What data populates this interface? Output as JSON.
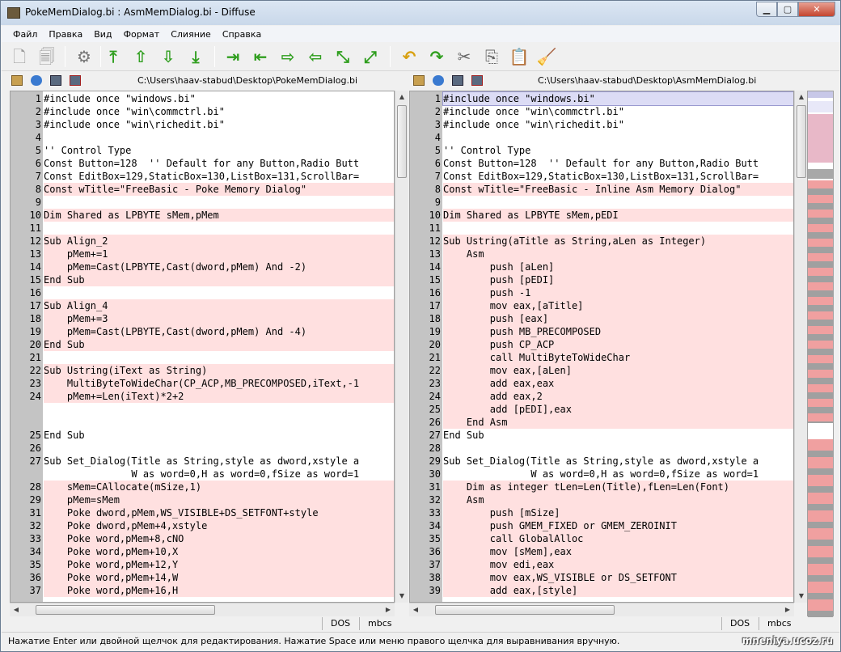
{
  "window": {
    "title": "PokeMemDialog.bi : AsmMemDialog.bi - Diffuse",
    "min_glyph": "▁",
    "max_glyph": "▢",
    "close_glyph": "✕"
  },
  "menu": [
    "Файл",
    "Правка",
    "Вид",
    "Формат",
    "Слияние",
    "Справка"
  ],
  "toolbar_icons": [
    {
      "name": "new-file-icon",
      "glyph": "🗋"
    },
    {
      "name": "new-2way-icon",
      "glyph": "🗐"
    },
    {
      "name": "preferences-icon",
      "glyph": "⚙"
    },
    {
      "name": "first-change-icon",
      "glyph": "⤒"
    },
    {
      "name": "previous-change-icon",
      "glyph": "⇧"
    },
    {
      "name": "next-change-icon",
      "glyph": "⇩"
    },
    {
      "name": "last-change-icon",
      "glyph": "⤓"
    },
    {
      "name": "copy-right-icon",
      "glyph": "⇥"
    },
    {
      "name": "copy-left-icon",
      "glyph": "⇤"
    },
    {
      "name": "copy-selection-right-icon",
      "glyph": "⇨"
    },
    {
      "name": "copy-selection-left-icon",
      "glyph": "⇦"
    },
    {
      "name": "merge-from-left-right-icon",
      "glyph": "⤡"
    },
    {
      "name": "merge-from-right-left-icon",
      "glyph": "⤢"
    },
    {
      "name": "undo-icon",
      "glyph": "↶"
    },
    {
      "name": "redo-icon",
      "glyph": "↷"
    },
    {
      "name": "cut-icon",
      "glyph": "✂"
    },
    {
      "name": "copy-icon",
      "glyph": "⎘"
    },
    {
      "name": "paste-icon",
      "glyph": "📋"
    },
    {
      "name": "clear-edits-icon",
      "glyph": "🧹"
    }
  ],
  "left_pane": {
    "path": "C:\\Users\\haav-stabud\\Desktop\\PokeMemDialog.bi",
    "eol": "DOS",
    "encoding": "mbcs",
    "lines": [
      {
        "n": "1",
        "t": "#include once \"windows.bi\"",
        "s": "plain"
      },
      {
        "n": "2",
        "t": "#include once \"win\\commctrl.bi\"",
        "s": "plain"
      },
      {
        "n": "3",
        "t": "#include once \"win\\richedit.bi\"",
        "s": "plain"
      },
      {
        "n": "4",
        "t": "",
        "s": "plain"
      },
      {
        "n": "5",
        "t": "'' Control Type",
        "s": "plain"
      },
      {
        "n": "6",
        "t": "Const Button=128  '' Default for any Button,Radio Butt",
        "s": "plain"
      },
      {
        "n": "7",
        "t": "Const EditBox=129,StaticBox=130,ListBox=131,ScrollBar=",
        "s": "plain"
      },
      {
        "n": "8",
        "t": "Const wTitle=\"FreeBasic - Poke Memory Dialog\"",
        "s": "diff"
      },
      {
        "n": "9",
        "t": "",
        "s": "plain"
      },
      {
        "n": "10",
        "t": "Dim Shared as LPBYTE sMem,pMem",
        "s": "diff"
      },
      {
        "n": "11",
        "t": "",
        "s": "plain"
      },
      {
        "n": "12",
        "t": "Sub Align_2",
        "s": "diff"
      },
      {
        "n": "13",
        "t": "    pMem+=1",
        "s": "diff"
      },
      {
        "n": "14",
        "t": "    pMem=Cast(LPBYTE,Cast(dword,pMem) And -2)",
        "s": "diff"
      },
      {
        "n": "15",
        "t": "End Sub",
        "s": "diff"
      },
      {
        "n": "16",
        "t": "",
        "s": "diff"
      },
      {
        "n": "17",
        "t": "Sub Align_4",
        "s": "diff"
      },
      {
        "n": "18",
        "t": "    pMem+=3",
        "s": "diff"
      },
      {
        "n": "19",
        "t": "    pMem=Cast(LPBYTE,Cast(dword,pMem) And -4)",
        "s": "diff"
      },
      {
        "n": "20",
        "t": "End Sub",
        "s": "diff"
      },
      {
        "n": "21",
        "t": "",
        "s": "diff"
      },
      {
        "n": "22",
        "t": "Sub Ustring(iText as String)",
        "s": "diff"
      },
      {
        "n": "23",
        "t": "    MultiByteToWideChar(CP_ACP,MB_PRECOMPOSED,iText,-1",
        "s": "diff"
      },
      {
        "n": "24",
        "t": "    pMem+=Len(iText)*2+2",
        "s": "diff"
      },
      {
        "n": "",
        "t": "",
        "s": "filler"
      },
      {
        "n": "",
        "t": "",
        "s": "filler"
      },
      {
        "n": "25",
        "t": "End Sub",
        "s": "plain"
      },
      {
        "n": "26",
        "t": "",
        "s": "plain"
      },
      {
        "n": "27",
        "t": "Sub Set_Dialog(Title as String,style as dword,xstyle a",
        "s": "plain"
      },
      {
        "n": "",
        "t": "               W as word=0,H as word=0,fSize as word=1",
        "s": "plain"
      },
      {
        "n": "28",
        "t": "    sMem=CAllocate(mSize,1)",
        "s": "diff"
      },
      {
        "n": "29",
        "t": "    pMem=sMem",
        "s": "diff"
      },
      {
        "n": "31",
        "t": "    Poke dword,pMem,WS_VISIBLE+DS_SETFONT+style",
        "s": "diff"
      },
      {
        "n": "32",
        "t": "    Poke dword,pMem+4,xstyle",
        "s": "diff"
      },
      {
        "n": "33",
        "t": "    Poke word,pMem+8,cNO",
        "s": "diff"
      },
      {
        "n": "34",
        "t": "    Poke word,pMem+10,X",
        "s": "diff"
      },
      {
        "n": "35",
        "t": "    Poke word,pMem+12,Y",
        "s": "diff"
      },
      {
        "n": "36",
        "t": "    Poke word,pMem+14,W",
        "s": "diff"
      },
      {
        "n": "37",
        "t": "    Poke word,pMem+16,H",
        "s": "diff"
      }
    ]
  },
  "right_pane": {
    "path": "C:\\Users\\haav-stabud\\Desktop\\AsmMemDialog.bi",
    "eol": "DOS",
    "encoding": "mbcs",
    "lines": [
      {
        "n": "1",
        "t": "#include once \"windows.bi\"",
        "s": "cur"
      },
      {
        "n": "2",
        "t": "#include once \"win\\commctrl.bi\"",
        "s": "plain"
      },
      {
        "n": "3",
        "t": "#include once \"win\\richedit.bi\"",
        "s": "plain"
      },
      {
        "n": "4",
        "t": "",
        "s": "plain"
      },
      {
        "n": "5",
        "t": "'' Control Type",
        "s": "plain"
      },
      {
        "n": "6",
        "t": "Const Button=128  '' Default for any Button,Radio Butt",
        "s": "plain"
      },
      {
        "n": "7",
        "t": "Const EditBox=129,StaticBox=130,ListBox=131,ScrollBar=",
        "s": "plain"
      },
      {
        "n": "8",
        "t": "Const wTitle=\"FreeBasic - Inline Asm Memory Dialog\"",
        "s": "diff"
      },
      {
        "n": "9",
        "t": "",
        "s": "plain"
      },
      {
        "n": "10",
        "t": "Dim Shared as LPBYTE sMem,pEDI",
        "s": "diff"
      },
      {
        "n": "11",
        "t": "",
        "s": "plain"
      },
      {
        "n": "12",
        "t": "Sub Ustring(aTitle as String,aLen as Integer)",
        "s": "diff"
      },
      {
        "n": "13",
        "t": "    Asm",
        "s": "diff"
      },
      {
        "n": "14",
        "t": "        push [aLen]",
        "s": "diff"
      },
      {
        "n": "15",
        "t": "        push [pEDI]",
        "s": "diff"
      },
      {
        "n": "16",
        "t": "        push -1",
        "s": "diff"
      },
      {
        "n": "17",
        "t": "        mov eax,[aTitle]",
        "s": "diff"
      },
      {
        "n": "18",
        "t": "        push [eax]",
        "s": "diff"
      },
      {
        "n": "19",
        "t": "        push MB_PRECOMPOSED",
        "s": "diff"
      },
      {
        "n": "20",
        "t": "        push CP_ACP",
        "s": "diff"
      },
      {
        "n": "21",
        "t": "        call MultiByteToWideChar",
        "s": "diff"
      },
      {
        "n": "22",
        "t": "        mov eax,[aLen]",
        "s": "diff"
      },
      {
        "n": "23",
        "t": "        add eax,eax",
        "s": "diff"
      },
      {
        "n": "24",
        "t": "        add eax,2",
        "s": "diff"
      },
      {
        "n": "25",
        "t": "        add [pEDI],eax",
        "s": "diff"
      },
      {
        "n": "26",
        "t": "    End Asm",
        "s": "diff"
      },
      {
        "n": "27",
        "t": "End Sub",
        "s": "plain"
      },
      {
        "n": "28",
        "t": "",
        "s": "plain"
      },
      {
        "n": "29",
        "t": "Sub Set_Dialog(Title as String,style as dword,xstyle a",
        "s": "plain"
      },
      {
        "n": "30",
        "t": "               W as word=0,H as word=0,fSize as word=1",
        "s": "plain"
      },
      {
        "n": "31",
        "t": "    Dim as integer tLen=Len(Title),fLen=Len(Font)",
        "s": "diff"
      },
      {
        "n": "32",
        "t": "    Asm",
        "s": "diff"
      },
      {
        "n": "33",
        "t": "        push [mSize]",
        "s": "diff"
      },
      {
        "n": "34",
        "t": "        push GMEM_FIXED or GMEM_ZEROINIT",
        "s": "diff"
      },
      {
        "n": "35",
        "t": "        call GlobalAlloc",
        "s": "diff"
      },
      {
        "n": "36",
        "t": "        mov [sMem],eax",
        "s": "diff"
      },
      {
        "n": "37",
        "t": "        mov edi,eax",
        "s": "diff"
      },
      {
        "n": "38",
        "t": "        mov eax,WS_VISIBLE or DS_SETFONT",
        "s": "diff"
      },
      {
        "n": "39",
        "t": "        add eax,[style]",
        "s": "diff"
      }
    ]
  },
  "status": {
    "text": "Нажатие Enter или двойной щелчок для редактирования.  Нажатие Space или меню правого щелчка для выравнивания вручную.",
    "watermark": "mneniya.ucoz.ru"
  },
  "colors": {
    "diff_bg": "#ffe0e0",
    "current_line": "#dcdcf5",
    "gutter": "#c4c4c4",
    "toolbar_green": "#2f9e1e"
  }
}
